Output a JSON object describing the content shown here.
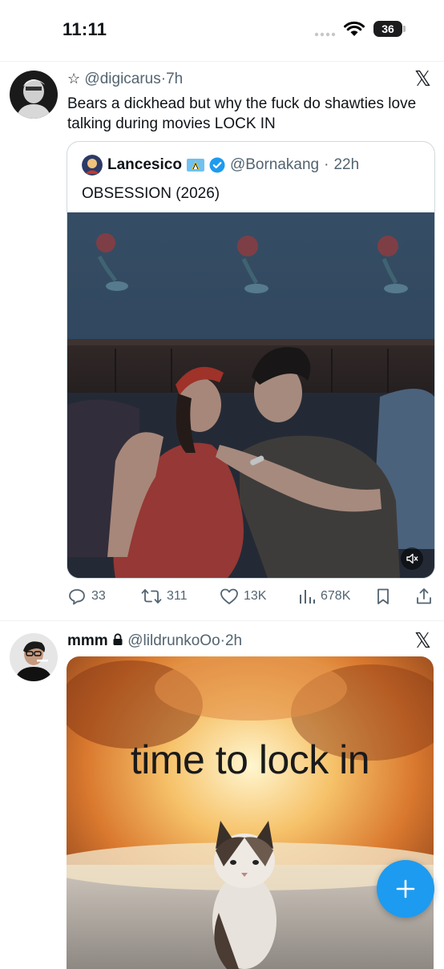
{
  "status_bar": {
    "time": "11:11",
    "battery": "36"
  },
  "tweet1": {
    "handle": "@digicarus",
    "time": "7h",
    "text": "Bears a dickhead but why the fuck do shawties love talking during movies LOCK IN",
    "quote": {
      "name": "Lancesico",
      "handle": "@Bornakang",
      "time": "22h",
      "text": "OBSESSION (2026)"
    },
    "actions": {
      "replies": "33",
      "reposts": "311",
      "likes": "13K",
      "views": "678K"
    }
  },
  "tweet2": {
    "name": "mmm",
    "handle": "@lildrunkoOo",
    "time": "2h",
    "image_text": "time to lock in"
  },
  "colors": {
    "accent": "#1d9bf0",
    "muted": "#536471",
    "border": "#cfd9de"
  }
}
